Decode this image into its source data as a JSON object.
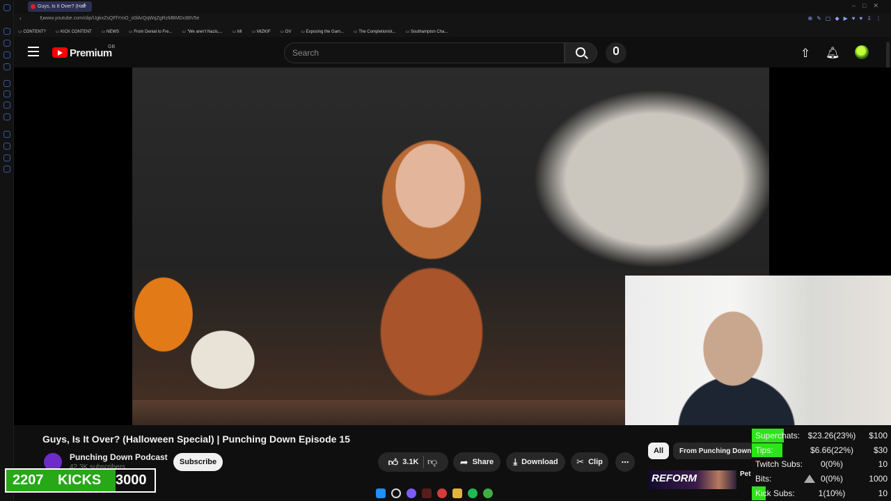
{
  "browser": {
    "tab_title": "Guys, Is It Over? (Hall",
    "url": "www.youtube.com/clip/UgkxZsQFfYmO_o0lArQqWqZgRzMBMDc88V5e",
    "bookmarks": [
      "CONTENT?",
      "KICK CONTENT",
      "NEWS",
      "From Denial to Fre...",
      "\"We aren't Nazis,...",
      "MI",
      "MIZKIF",
      "DV",
      "Exposing the Gam...",
      "The Completionist...",
      "Southampton Cha..."
    ]
  },
  "header": {
    "logo_text": "Premium",
    "logo_country": "GB",
    "search_placeholder": "Search"
  },
  "video": {
    "title": "Guys, Is It Over? (Halloween Special) | Punching Down Episode 15",
    "channel_name": "Punching Down Podcast",
    "channel_subs": "42.3K subscribers",
    "subscribe_label": "Subscribe",
    "like_count": "3.1K",
    "share_label": "Share",
    "download_label": "Download",
    "clip_label": "Clip"
  },
  "recommendations": {
    "chips": [
      "All",
      "From Punching Down"
    ],
    "thumb_text": "REFORM",
    "side_text": "Pet Ref"
  },
  "kick_counter": {
    "current": "2207",
    "label": "KICKS",
    "goal": "3000",
    "progress": 0.7357
  },
  "goals": [
    {
      "label": "Superchats:",
      "value": "$23.26(23%)",
      "goal": "$100",
      "progress": 0.23
    },
    {
      "label": "Tips:",
      "value": "$6.66(22%)",
      "goal": "$30",
      "progress": 0.22
    },
    {
      "label": "Twitch Subs:",
      "value": "0(0%)",
      "goal": "10",
      "progress": 0
    },
    {
      "label": "Bits:",
      "value": "0(0%)",
      "goal": "1000",
      "progress": 0
    },
    {
      "label": "Kick Subs:",
      "value": "1(10%)",
      "goal": "10",
      "progress": 0.1
    }
  ]
}
